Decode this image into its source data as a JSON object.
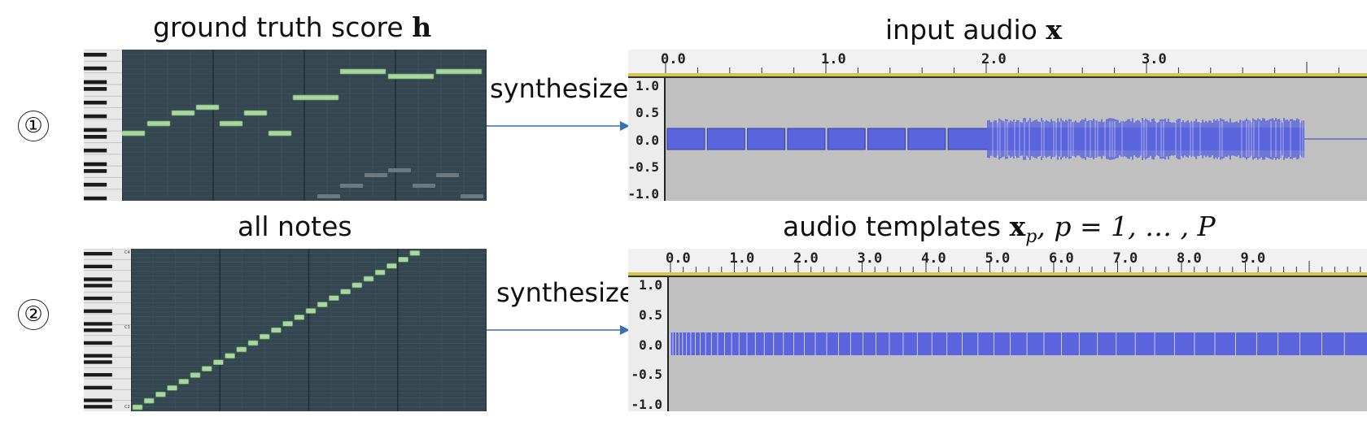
{
  "row1": {
    "number": "①",
    "score_title": "ground truth score",
    "score_symbol": "h",
    "synthesize_label": "synthesize",
    "audio_title": "input audio",
    "audio_symbol": "x",
    "time_ticks": [
      "0.0",
      "1.0",
      "2.0",
      "3.0"
    ],
    "amp_ticks": [
      "1.0",
      "0.5",
      "0.0",
      "-0.5",
      "-1.0"
    ]
  },
  "row2": {
    "number": "②",
    "score_title": "all notes",
    "synthesize_label": "synthesize",
    "audio_title": "audio templates",
    "audio_symbol": "x",
    "audio_subscript": "p",
    "audio_formula_tail": ", p = 1, … , P",
    "time_ticks": [
      "0.0",
      "1.0",
      "2.0",
      "3.0",
      "4.0",
      "5.0",
      "6.0",
      "7.0",
      "8.0",
      "9.0"
    ],
    "amp_ticks": [
      "1.0",
      "0.5",
      "0.0",
      "-0.5",
      "-1.0"
    ],
    "key_labels": [
      "C4",
      "C3",
      "C2"
    ]
  },
  "colors": {
    "piano_bg": "#34464f",
    "note_green": "#a8d8a0",
    "note_gray": "#6a7a80",
    "waveform": "#5a64dc",
    "audio_bg": "#c0c0c0",
    "arrow": "#3a6fb5"
  },
  "icons": [
    "arrow-right-icon"
  ]
}
